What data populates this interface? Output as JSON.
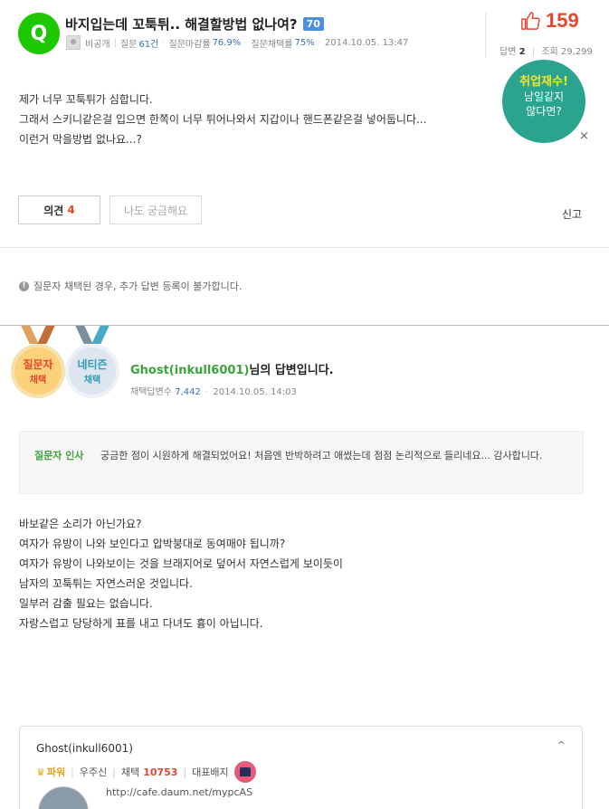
{
  "question": {
    "badge": "Q",
    "title": "바지입는데 꼬툭튀.. 해결할방법 없나여?",
    "points": "70",
    "author": "비공개",
    "meta": {
      "q_label": "질문",
      "q_count": "61건",
      "close_label": "질문마감률",
      "close_rate": "76.9%",
      "adopt_label": "질문채택률",
      "adopt_rate": "75%",
      "date": "2014.10.05. 13:47"
    },
    "likes": "159",
    "answers_label": "답변",
    "answers": "2",
    "views_label": "조회",
    "views": "29,299",
    "body": [
      "제가 너무 꼬툭튀가 심합니다.",
      "그래서 스키니같은걸 입으면 한쪽이 너무 튀어나와서 지갑이나 핸드폰같은걸 넣어둡니다...",
      "이런거 막을방법 없나요...?"
    ],
    "opinion_label": "의견",
    "opinion_count": "4",
    "curious_label": "나도 궁금해요",
    "report_label": "신고"
  },
  "promo": {
    "line1": "취업재수!",
    "line2": "남일같지",
    "line3": "않다면?",
    "close": "×"
  },
  "notice": "질문자 채택된 경우, 추가 답변 등록이 불가합니다.",
  "answer": {
    "medal_asker": {
      "line1": "질문자",
      "line2": "채택"
    },
    "medal_net": {
      "line1": "네티즌",
      "line2": "채택"
    },
    "user": "Ghost(inkull6001)",
    "title_suffix": "님의 답변입니다.",
    "adopt_label": "채택답변수",
    "adopt_count": "7,442",
    "date": "2014.10.05. 14:03",
    "thanks_label": "질문자 인사",
    "thanks_text": "궁금한 점이 시원하게 해결되었어요! 처음엔 반박하려고 애썼는데 점점 논리적으로 들리네요... 감사합니다.",
    "body": [
      "바보같은 소리가 아닌가요?",
      "여자가 유방이 나와 보인다고 압박붕대로 동여매야 됩니까?",
      "여자가 유방이 나와보이는 것을 브래지어로 덮어서 자연스럽게 보이듯이",
      "남자의 꼬툭튀는 자연스러운 것입니다.",
      "일부러 감출 필요는 없습니다.",
      "자랑스럽고 당당하게 표를 내고 다녀도 흉이 아닙니다."
    ]
  },
  "profile": {
    "name": "Ghost(inkull6001)",
    "power": "파워",
    "rank": "우주신",
    "adopt_label": "채택",
    "adopt_count": "10753",
    "badge_label": "대표배지",
    "link": "http://cafe.daum.net/mypcAS"
  },
  "colors": {
    "green": "#1ec800",
    "accent_red": "#e8452c",
    "promo_teal": "#2aa38f",
    "link_blue": "#3b6fb6"
  }
}
